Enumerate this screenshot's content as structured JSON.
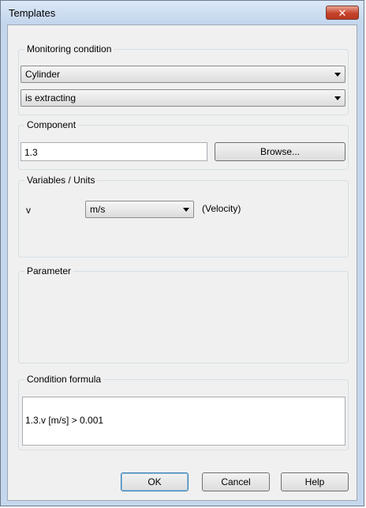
{
  "window": {
    "title": "Templates",
    "close_glyph": "✕"
  },
  "monitoring": {
    "label": "Monitoring condition",
    "component_type": "Cylinder",
    "condition": "is extracting"
  },
  "component": {
    "label": "Component",
    "value": "1.3",
    "browse_label": "Browse..."
  },
  "variables": {
    "label": "Variables / Units",
    "var_name": "v",
    "unit": "m/s",
    "description": "(Velocity)"
  },
  "parameter": {
    "label": "Parameter"
  },
  "formula": {
    "label": "Condition formula",
    "text": "1.3.v [m/s] > 0.001"
  },
  "buttons": {
    "ok": "OK",
    "cancel": "Cancel",
    "help": "Help"
  }
}
